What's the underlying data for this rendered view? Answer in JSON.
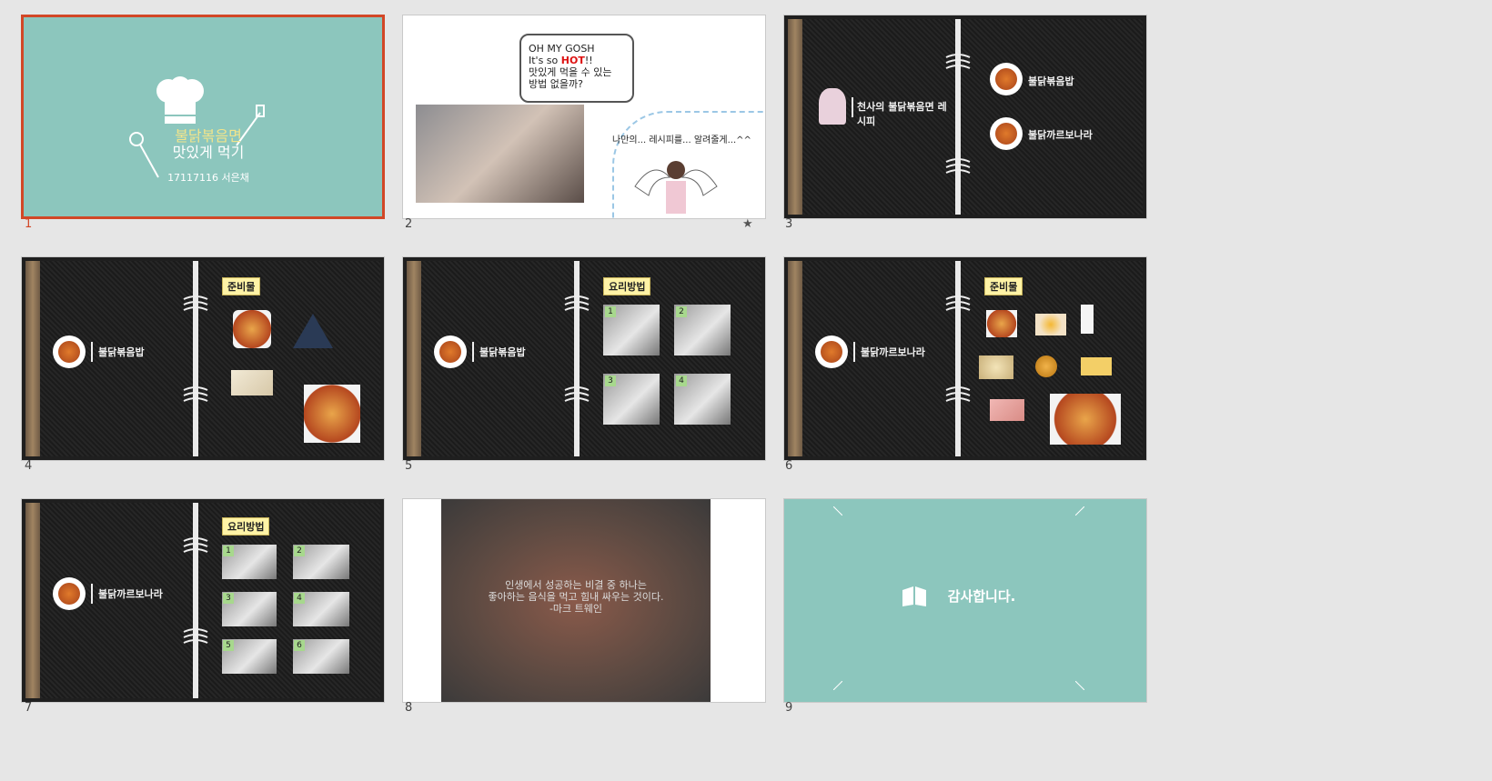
{
  "slides": [
    {
      "number": "1",
      "title": "불닭볶음면",
      "subtitle": "맛있게 먹기",
      "author": "17117116 서은채"
    },
    {
      "number": "2",
      "bubble": [
        "OH MY GOSH",
        "It's so",
        "HOT",
        "!!",
        "맛있게 먹을 수 있는",
        "방법 없을까?"
      ],
      "reply": "나만의... 레시피를... 알려줄게...^^",
      "star": "★"
    },
    {
      "number": "3",
      "heading": "천사의 불닭볶음면 레시피",
      "items": [
        "불닭볶음밥",
        "불닭까르보나라"
      ]
    },
    {
      "number": "4",
      "label": "불닭볶음밥",
      "tag": "준비물"
    },
    {
      "number": "5",
      "label": "불닭볶음밥",
      "tag": "요리방법",
      "steps": [
        "1",
        "2",
        "3",
        "4"
      ]
    },
    {
      "number": "6",
      "label": "불닭까르보나라",
      "tag": "준비물"
    },
    {
      "number": "7",
      "label": "불닭까르보나라",
      "tag": "요리방법",
      "steps": [
        "1",
        "2",
        "3",
        "4",
        "5",
        "6"
      ]
    },
    {
      "number": "8",
      "quote": [
        "인생에서 성공하는 비결 중 하나는",
        "좋아하는 음식을 먹고 힘내 싸우는 것이다.",
        "-마크 트웨인"
      ]
    },
    {
      "number": "9",
      "thanks": "감사합니다."
    }
  ]
}
